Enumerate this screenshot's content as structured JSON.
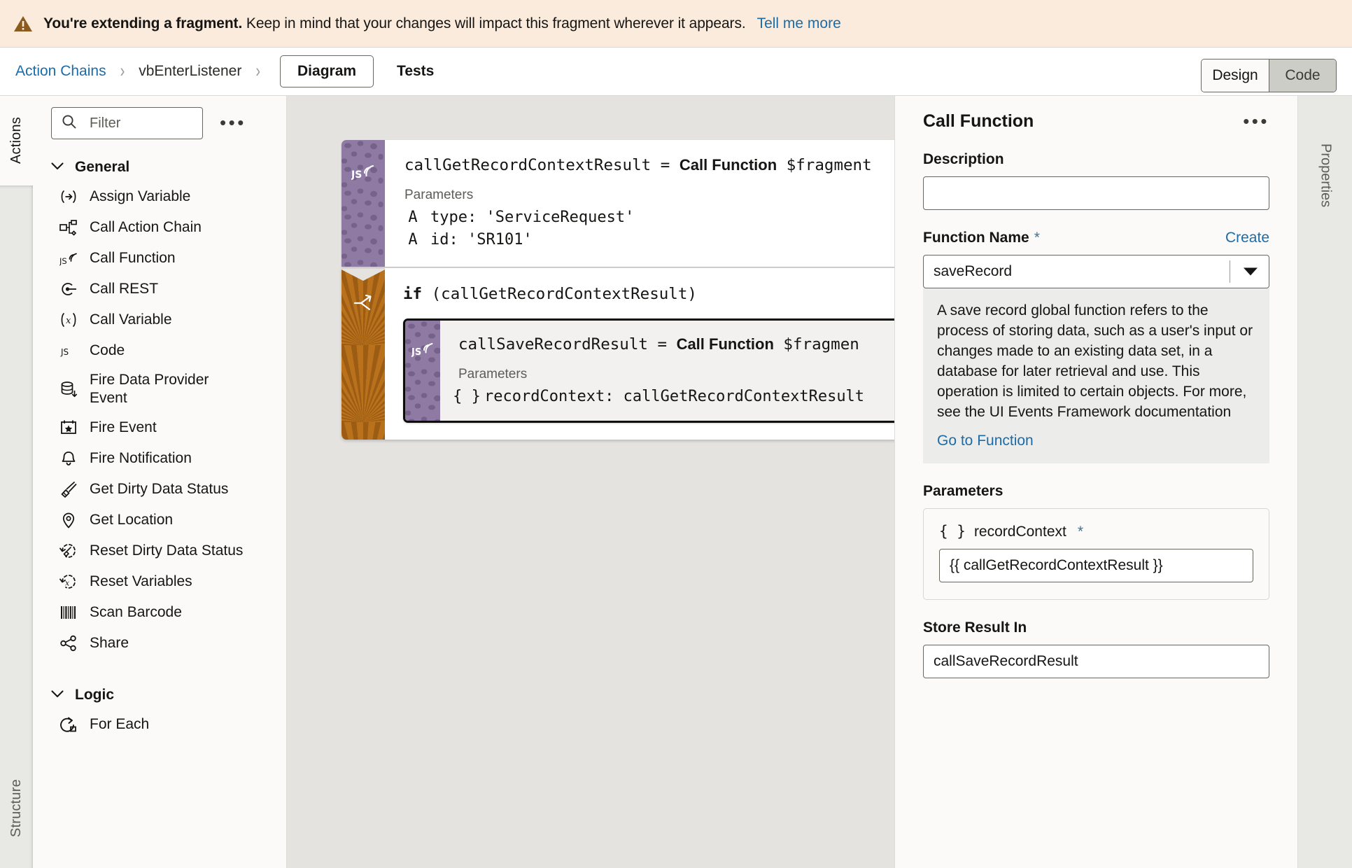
{
  "banner": {
    "icon": "warning-triangle-icon",
    "bold_text": "You're extending a fragment.",
    "rest_text": " Keep in mind that your changes will impact this fragment wherever it appears.",
    "link": "Tell me more",
    "bg_color": "#faebdc",
    "icon_color": "#8a5a1e"
  },
  "toolbar": {
    "breadcrumb": [
      {
        "label": "Action Chains",
        "link": true
      },
      {
        "label": "vbEnterListener",
        "link": false
      }
    ],
    "separator": "›",
    "tabs": [
      {
        "label": "Diagram",
        "active": true
      },
      {
        "label": "Tests",
        "active": false
      }
    ],
    "mode_toggle": [
      {
        "label": "Design",
        "active": true
      },
      {
        "label": "Code",
        "active": false
      }
    ]
  },
  "left_rail": {
    "active_tab": "Actions",
    "inactive_tab": "Structure"
  },
  "actions_panel": {
    "filter": {
      "placeholder": "Filter",
      "value": "",
      "icon": "search-icon"
    },
    "overflow_menu": "•••",
    "groups": [
      {
        "label": "General",
        "expanded": true,
        "items": [
          {
            "label": "Assign Variable",
            "icon": "assign-variable-icon"
          },
          {
            "label": "Call Action Chain",
            "icon": "call-action-chain-icon"
          },
          {
            "label": "Call Function",
            "icon": "call-function-js-icon"
          },
          {
            "label": "Call REST",
            "icon": "call-rest-icon"
          },
          {
            "label": "Call Variable",
            "icon": "call-variable-icon"
          },
          {
            "label": "Code",
            "icon": "code-js-icon"
          },
          {
            "label": "Fire Data Provider Event",
            "icon": "fire-data-provider-event-icon",
            "two_line": true
          },
          {
            "label": "Fire Event",
            "icon": "fire-event-icon"
          },
          {
            "label": "Fire Notification",
            "icon": "fire-notification-bell-icon"
          },
          {
            "label": "Get Dirty Data Status",
            "icon": "get-dirty-data-status-icon"
          },
          {
            "label": "Get Location",
            "icon": "get-location-pin-icon"
          },
          {
            "label": "Reset Dirty Data Status",
            "icon": "reset-dirty-data-status-icon"
          },
          {
            "label": "Reset Variables",
            "icon": "reset-variables-icon"
          },
          {
            "label": "Scan Barcode",
            "icon": "scan-barcode-icon"
          },
          {
            "label": "Share",
            "icon": "share-icon"
          }
        ]
      },
      {
        "label": "Logic",
        "expanded": true,
        "items": [
          {
            "label": "For Each",
            "icon": "for-each-loop-icon"
          }
        ]
      }
    ]
  },
  "diagram": {
    "nodes": [
      {
        "kind": "call-function",
        "band_color": "#8e7aa3",
        "band_icon": "js-call-function-icon",
        "code": "callGetRecordContextResult = ",
        "code_bold": "Call Function",
        "code_tail": " $fragment",
        "parameters_label": "Parameters",
        "parameters": [
          {
            "type_glyph": "A",
            "text": "type: 'ServiceRequest'"
          },
          {
            "type_glyph": "A",
            "text": "id: 'SR101'"
          }
        ]
      },
      {
        "kind": "if-branch",
        "band_color": "#b9711c",
        "band_icon": "branch-fork-icon",
        "title_keyword": "if",
        "title_rest": " (callGetRecordContextResult)",
        "child": {
          "kind": "call-function",
          "selected": true,
          "band_color": "#8e7aa3",
          "band_icon": "js-call-function-icon",
          "code": "callSaveRecordResult = ",
          "code_bold": "Call Function",
          "code_tail": " $fragmen",
          "parameters_label": "Parameters",
          "parameters": [
            {
              "type_glyph": "{ }",
              "text": "recordContext: callGetRecordContextResult"
            }
          ]
        }
      }
    ]
  },
  "properties": {
    "title": "Call Function",
    "overflow_menu": "•••",
    "description": {
      "label": "Description",
      "value": "",
      "placeholder": ""
    },
    "function_name": {
      "label": "Function Name",
      "required_marker": "*",
      "create_link": "Create",
      "value": "saveRecord",
      "caret_icon": "chevron-down-icon"
    },
    "help": {
      "text": "A save record global function refers to the process of storing data, such as a user's input or changes made to an existing data set, in a database for later retrieval and use. This operation is limited to certain objects. For more, see the UI Events Framework documentation",
      "link": "Go to Function"
    },
    "parameters": {
      "label": "Parameters",
      "items": [
        {
          "type_glyph": "{ }",
          "name": "recordContext",
          "required_marker": "*",
          "value": "{{ callGetRecordContextResult }}"
        }
      ]
    },
    "store_result_in": {
      "label": "Store Result In",
      "value": "callSaveRecordResult"
    }
  },
  "right_rail": {
    "tab": "Properties"
  }
}
